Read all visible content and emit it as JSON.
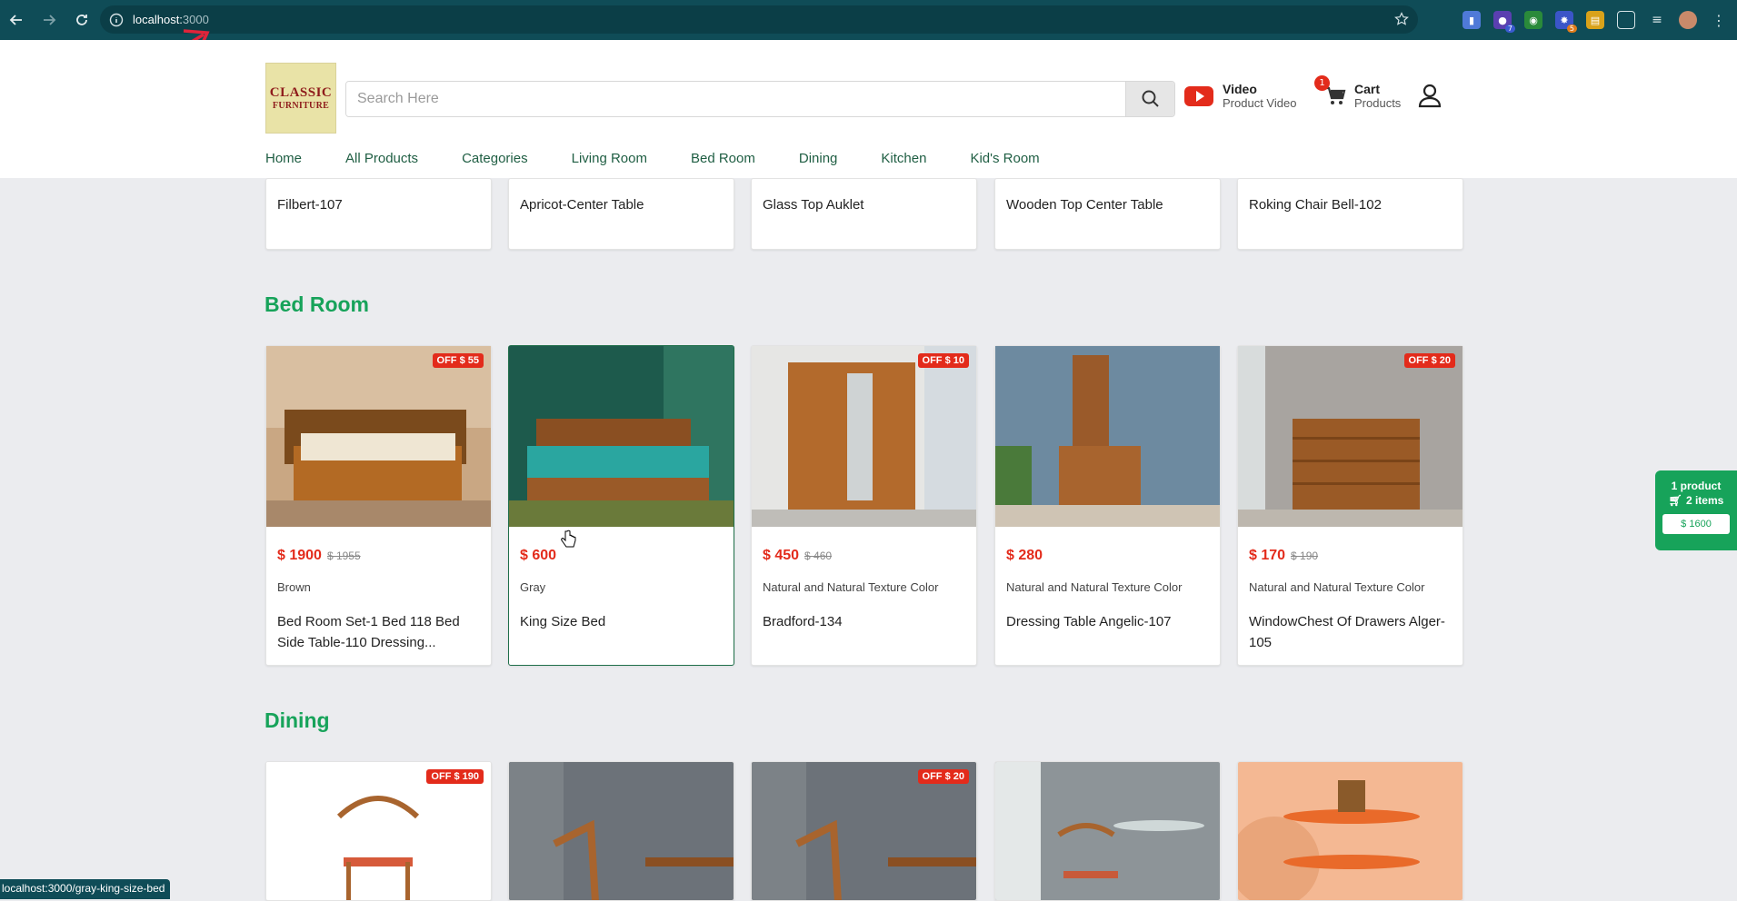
{
  "browser": {
    "url_host": "localhost:",
    "url_port": "3000",
    "status_url": "localhost:3000/gray-king-size-bed",
    "extension_badges": [
      "7",
      "5"
    ]
  },
  "header": {
    "logo_line1": "CLASSIC",
    "logo_line2": "FURNITURE",
    "search_placeholder": "Search Here",
    "video_title": "Video",
    "video_sub": "Product Video",
    "cart_title": "Cart",
    "cart_sub": "Products",
    "cart_count": "1"
  },
  "nav": {
    "items": [
      "Home",
      "All Products",
      "Categories",
      "Living Room",
      "Bed Room",
      "Dining",
      "Kitchen",
      "Kid's Room"
    ]
  },
  "top_row": {
    "items": [
      "Filbert-107",
      "Apricot-Center Table",
      "Glass Top Auklet",
      "Wooden Top Center Table",
      "Roking Chair Bell-102"
    ]
  },
  "bedroom": {
    "title": "Bed Room",
    "products": [
      {
        "off": "OFF $ 55",
        "price": "$ 1900",
        "old": "$ 1955",
        "color": "Brown",
        "name": "Bed Room Set-1 Bed 118 Bed Side Table-110 Dressing..."
      },
      {
        "off": "",
        "price": "$ 600",
        "old": "",
        "color": "Gray",
        "name": "King Size Bed"
      },
      {
        "off": "OFF $ 10",
        "price": "$ 450",
        "old": "$ 460",
        "color": "Natural and Natural Texture Color",
        "name": "Bradford-134"
      },
      {
        "off": "",
        "price": "$ 280",
        "old": "",
        "color": "Natural and Natural Texture Color",
        "name": "Dressing Table Angelic-107"
      },
      {
        "off": "OFF $ 20",
        "price": "$ 170",
        "old": "$ 190",
        "color": "Natural and Natural Texture Color",
        "name": "WindowChest Of Drawers Alger-105"
      }
    ]
  },
  "dining": {
    "title": "Dining",
    "offs": [
      "OFF $ 190",
      "",
      "OFF $ 20",
      "",
      ""
    ]
  },
  "side_cart": {
    "line1": "1 product",
    "line2": "2 items",
    "total": "$ 1600"
  },
  "colors": {
    "brand_green": "#17a35a",
    "chrome": "#0f4c57",
    "price_red": "#e32b1b"
  }
}
